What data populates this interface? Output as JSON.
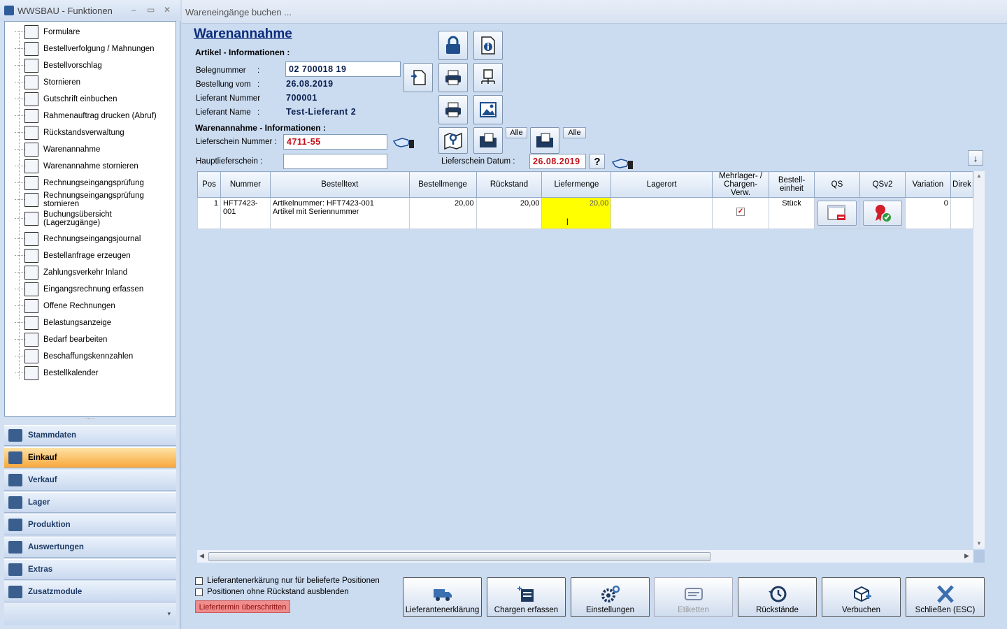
{
  "left_window": {
    "title": "WWSBAU - Funktionen",
    "minimize": "–",
    "maximize": "▭",
    "close": "✕",
    "tree_items": [
      {
        "label": "Formulare",
        "icon": "document-icon"
      },
      {
        "label": "Bestellverfolgung / Mahnungen",
        "icon": "map-icon"
      },
      {
        "label": "Bestellvorschlag",
        "icon": "cart-icon"
      },
      {
        "label": "Stornieren",
        "icon": "cart-cancel-icon"
      },
      {
        "label": "Gutschrift einbuchen",
        "icon": "credit-icon"
      },
      {
        "label": "Rahmenauftrag drucken (Abruf)",
        "icon": "print-document-icon"
      },
      {
        "label": "Rückstandsverwaltung",
        "icon": "history-icon"
      },
      {
        "label": "Warenannahme",
        "icon": "goods-receipt-icon"
      },
      {
        "label": "Warenannahme stornieren",
        "icon": "goods-receipt-cancel-icon"
      },
      {
        "label": "Rechnungseingangsprüfung",
        "icon": "invoice-check-icon"
      },
      {
        "label": "Rechnungseingangsprüfung stornieren",
        "icon": "invoice-cancel-icon"
      },
      {
        "label": "Buchungsübersicht (Lagerzugänge)",
        "icon": "ledger-icon"
      },
      {
        "label": "Rechnungseingangsjournal",
        "icon": "journal-icon"
      },
      {
        "label": "Bestellanfrage erzeugen",
        "icon": "request-icon"
      },
      {
        "label": "Zahlungsverkehr Inland",
        "icon": "payment-icon"
      },
      {
        "label": "Eingangsrechnung erfassen",
        "icon": "euro-icon"
      },
      {
        "label": "Offene Rechnungen",
        "icon": "euro-open-icon"
      },
      {
        "label": "Belastungsanzeige",
        "icon": "weight-icon"
      },
      {
        "label": "Bedarf bearbeiten",
        "icon": "calculator-icon"
      },
      {
        "label": "Beschaffungskennzahlen",
        "icon": "statistics-icon"
      },
      {
        "label": "Bestellkalender",
        "icon": "calendar-icon"
      }
    ],
    "splitter": "·····",
    "nav_items": [
      {
        "label": "Stammdaten",
        "icon": "master-data-icon"
      },
      {
        "label": "Einkauf",
        "icon": "shopping-cart-icon",
        "active": true
      },
      {
        "label": "Verkauf",
        "icon": "cash-register-icon"
      },
      {
        "label": "Lager",
        "icon": "warehouse-icon"
      },
      {
        "label": "Produktion",
        "icon": "production-icon"
      },
      {
        "label": "Auswertungen",
        "icon": "analysis-icon"
      },
      {
        "label": "Extras",
        "icon": "extras-icon"
      },
      {
        "label": "Zusatzmodule",
        "icon": "modules-icon"
      }
    ],
    "nav_footer": "▾"
  },
  "right_window": {
    "title": "Wareneingänge buchen ...",
    "form_title": "Warenannahme",
    "article_section": "Artikel - Informationen :",
    "fields": {
      "belegnummer_label": "Belegnummer",
      "belegnummer_value": "02 700018 19",
      "bestellung_label": "Bestellung vom",
      "bestellung_value": "26.08.2019",
      "lieferant_nr_label": "Lieferant Nummer",
      "lieferant_nr_value": "700001",
      "lieferant_name_label": "Lieferant Name",
      "lieferant_name_value": "Test-Lieferant 2",
      "colon": ":"
    },
    "receipt_section": "Warenannahme - Informationen :",
    "lieferschein_label": "Lieferschein Nummer :",
    "lieferschein_value": "4711-55",
    "hauptlieferschein_label": "Hauptlieferschein :",
    "hauptlieferschein_value": "",
    "lieferschein_datum_label": "Lieferschein Datum :",
    "lieferschein_datum_value": "26.08.2019",
    "help_label": "?",
    "alle_label_1": "Alle",
    "alle_label_2": "Alle",
    "sort_label": "↓"
  },
  "grid": {
    "columns": [
      "Pos",
      "Nummer",
      "Bestelltext",
      "Bestellmenge",
      "Rückstand",
      "Liefermenge",
      "Lagerort",
      "Mehrlager- / Chargen-Verw.",
      "Bestell-einheit",
      "QS",
      "QSv2",
      "Variation",
      "Direk"
    ],
    "rows": [
      {
        "pos": "1",
        "nummer": "HFT7423-001",
        "bestelltext_1": "Artikelnummer: HFT7423-001",
        "bestelltext_2": "Artikel mit Seriennummer",
        "bestellmenge": "20,00",
        "rueckstand": "20,00",
        "liefermenge": "20,00",
        "lagerort": "",
        "mehrlager_checked": true,
        "einheit": "Stück",
        "variation": "0",
        "direk": ""
      }
    ]
  },
  "options": {
    "checkbox_1": "Lieferantenerkärung nur für belieferte Positionen",
    "checkbox_2": "Positionen ohne Rückstand ausblenden",
    "late_badge": "Liefertermin überschritten"
  },
  "actions": [
    {
      "label": "Lieferantenerklärung",
      "icon": "truck-icon",
      "enabled": true
    },
    {
      "label": "Chargen erfassen",
      "icon": "batch-icon",
      "enabled": true
    },
    {
      "label": "Einstellungen",
      "icon": "settings-icon",
      "enabled": true
    },
    {
      "label": "Etiketten",
      "icon": "label-icon",
      "enabled": false
    },
    {
      "label": "Rückstände",
      "icon": "backlog-icon",
      "enabled": true
    },
    {
      "label": "Verbuchen",
      "icon": "book-icon",
      "enabled": true
    },
    {
      "label": "Schließen (ESC)",
      "icon": "close-x-icon",
      "enabled": true
    }
  ],
  "colors": {
    "accent": "#0b2a7a",
    "highlight_yellow": "#ffff00",
    "late_red": "#f08c8c",
    "active_nav": "#f9a73a"
  }
}
